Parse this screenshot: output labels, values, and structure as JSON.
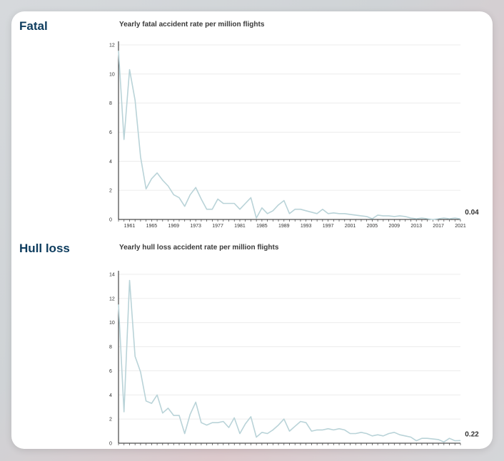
{
  "sections": [
    {
      "heading": "Fatal",
      "chart_title": "Yearly fatal accident rate per million flights"
    },
    {
      "heading": "Hull loss",
      "chart_title": "Yearly hull loss accident rate per million flights"
    }
  ],
  "chart_data": [
    {
      "type": "line",
      "title": "Yearly fatal accident rate per million flights",
      "xlabel": "",
      "ylabel": "",
      "xlim": [
        1959,
        2021
      ],
      "ylim": [
        0,
        12
      ],
      "yticks": [
        0,
        2,
        4,
        6,
        8,
        10,
        12
      ],
      "xticks": [
        1961,
        1965,
        1969,
        1973,
        1977,
        1981,
        1985,
        1989,
        1993,
        1997,
        2001,
        2005,
        2009,
        2013,
        2017,
        2021
      ],
      "grid": true,
      "color": "#b9d3d8",
      "end_label": "0.04",
      "series": [
        {
          "x": [
            1959,
            1960,
            1961,
            1962,
            1963,
            1964,
            1965,
            1966,
            1967,
            1968,
            1969,
            1970,
            1971,
            1972,
            1973,
            1974,
            1975,
            1976,
            1977,
            1978,
            1979,
            1980,
            1981,
            1982,
            1983,
            1984,
            1985,
            1986,
            1987,
            1988,
            1989,
            1990,
            1991,
            1992,
            1993,
            1994,
            1995,
            1996,
            1997,
            1998,
            1999,
            2000,
            2001,
            2002,
            2003,
            2004,
            2005,
            2006,
            2007,
            2008,
            2009,
            2010,
            2011,
            2012,
            2013,
            2014,
            2015,
            2016,
            2017,
            2018,
            2019,
            2020,
            2021
          ],
          "y": [
            11.6,
            5.5,
            10.3,
            8.2,
            4.3,
            2.1,
            2.8,
            3.2,
            2.7,
            2.3,
            1.7,
            1.5,
            0.9,
            1.7,
            2.2,
            1.4,
            0.7,
            0.7,
            1.4,
            1.1,
            1.1,
            1.1,
            0.7,
            1.1,
            1.5,
            0.1,
            0.8,
            0.4,
            0.6,
            1.0,
            1.3,
            0.4,
            0.7,
            0.7,
            0.6,
            0.5,
            0.4,
            0.7,
            0.4,
            0.45,
            0.4,
            0.4,
            0.35,
            0.3,
            0.25,
            0.2,
            0.05,
            0.3,
            0.25,
            0.25,
            0.2,
            0.25,
            0.2,
            0.1,
            0.05,
            0.1,
            0.05,
            0.0,
            0.05,
            0.1,
            0.05,
            0.1,
            0.04
          ]
        }
      ]
    },
    {
      "type": "line",
      "title": "Yearly hull loss accident rate per million flights",
      "xlabel": "",
      "ylabel": "",
      "xlim": [
        1959,
        2021
      ],
      "ylim": [
        0,
        14
      ],
      "yticks": [
        0,
        2,
        4,
        6,
        8,
        10,
        12,
        14
      ],
      "xticks": [
        1961,
        1965,
        1969,
        1973,
        1977,
        1981,
        1985,
        1989,
        1993,
        1997,
        2001,
        2005,
        2009,
        2013,
        2017,
        2021
      ],
      "grid": true,
      "color": "#b9d3d8",
      "end_label": "0.22",
      "series": [
        {
          "x": [
            1959,
            1960,
            1961,
            1962,
            1963,
            1964,
            1965,
            1966,
            1967,
            1968,
            1969,
            1970,
            1971,
            1972,
            1973,
            1974,
            1975,
            1976,
            1977,
            1978,
            1979,
            1980,
            1981,
            1982,
            1983,
            1984,
            1985,
            1986,
            1987,
            1988,
            1989,
            1990,
            1991,
            1992,
            1993,
            1994,
            1995,
            1996,
            1997,
            1998,
            1999,
            2000,
            2001,
            2002,
            2003,
            2004,
            2005,
            2006,
            2007,
            2008,
            2009,
            2010,
            2011,
            2012,
            2013,
            2014,
            2015,
            2016,
            2017,
            2018,
            2019,
            2020,
            2021
          ],
          "y": [
            11.5,
            2.6,
            13.5,
            7.2,
            5.9,
            3.5,
            3.3,
            4.0,
            2.5,
            2.9,
            2.3,
            2.3,
            0.8,
            2.4,
            3.4,
            1.7,
            1.5,
            1.7,
            1.7,
            1.8,
            1.3,
            2.1,
            0.8,
            1.6,
            2.2,
            0.5,
            0.9,
            0.8,
            1.1,
            1.5,
            2.0,
            1.0,
            1.4,
            1.8,
            1.7,
            1.0,
            1.1,
            1.1,
            1.2,
            1.1,
            1.2,
            1.1,
            0.8,
            0.8,
            0.9,
            0.8,
            0.6,
            0.7,
            0.6,
            0.8,
            0.9,
            0.7,
            0.6,
            0.5,
            0.2,
            0.4,
            0.4,
            0.35,
            0.3,
            0.1,
            0.4,
            0.2,
            0.22
          ]
        }
      ]
    }
  ]
}
